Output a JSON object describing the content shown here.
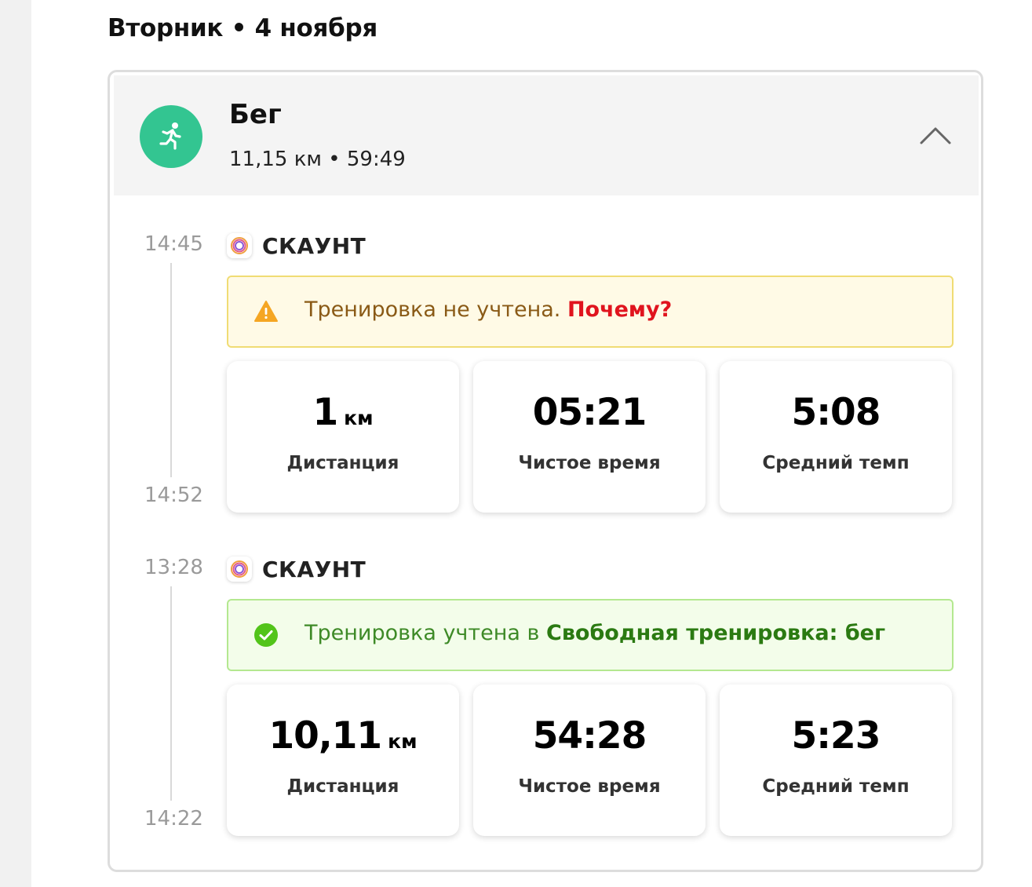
{
  "date_heading": "Вторник • 4 ноября",
  "activity": {
    "title": "Бег",
    "summary": "11,15 км • 59:49",
    "icon": "running-person-icon",
    "icon_color": "#33c591"
  },
  "sessions": [
    {
      "start_time": "14:45",
      "end_time": "14:52",
      "source": "СКАУНТ",
      "notice": {
        "type": "warning",
        "text": "Тренировка не учтена. ",
        "link": "Почему?",
        "icon": "warning-triangle-icon"
      },
      "stats": [
        {
          "value": "1",
          "unit": "км",
          "label": "Дистанция"
        },
        {
          "value": "05:21",
          "unit": "",
          "label": "Чистое время"
        },
        {
          "value": "5:08",
          "unit": "",
          "label": "Средний темп"
        }
      ]
    },
    {
      "start_time": "13:28",
      "end_time": "14:22",
      "source": "СКАУНТ",
      "notice": {
        "type": "success",
        "text": "Тренировка учтена в ",
        "link": "Свободная тренировка: бег",
        "icon": "check-circle-icon"
      },
      "stats": [
        {
          "value": "10,11",
          "unit": "км",
          "label": "Дистанция"
        },
        {
          "value": "54:28",
          "unit": "",
          "label": "Чистое время"
        },
        {
          "value": "5:23",
          "unit": "",
          "label": "Средний темп"
        }
      ]
    }
  ],
  "colors": {
    "warning_accent": "#f5a623",
    "warning_link": "#e0141e",
    "success_accent": "#52c41a",
    "success_link": "#2b7a12"
  }
}
